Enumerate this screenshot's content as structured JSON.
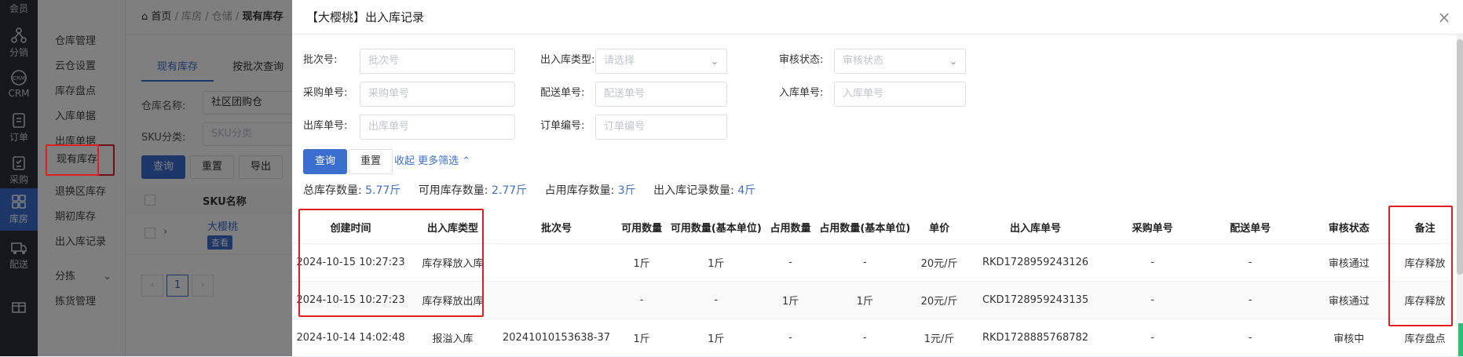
{
  "nav": {
    "items": [
      {
        "label": "会员",
        "icon": "member-icon"
      },
      {
        "label": "分销",
        "icon": "distribution-icon"
      },
      {
        "label": "CRM",
        "icon": "crm-icon"
      },
      {
        "label": "订单",
        "icon": "order-icon"
      },
      {
        "label": "采购",
        "icon": "purchase-icon"
      },
      {
        "label": "库房",
        "icon": "warehouse-icon"
      },
      {
        "label": "配送",
        "icon": "delivery-icon"
      },
      {
        "label": "",
        "icon": "gift-icon"
      }
    ]
  },
  "submenu": {
    "items": [
      "仓库管理",
      "云仓设置",
      "库存盘点",
      "入库单据",
      "出库单据",
      "现有库存",
      "退换区库存",
      "期初库存",
      "出入库记录",
      "分拣",
      "拣货管理"
    ]
  },
  "breadcrumb": {
    "home": "首页",
    "sep1": "/",
    "level1": "库房",
    "sep2": "/",
    "level2": "仓储",
    "sep3": "/",
    "current": "现有库存"
  },
  "bg": {
    "tabs": [
      "现有库存",
      "按批次查询"
    ],
    "warehouse_label": "仓库名称:",
    "warehouse_value": "社区团购仓",
    "sku_label": "SKU分类:",
    "sku_placeholder": "SKU分类",
    "btn_query": "查询",
    "btn_reset": "重置",
    "btn_export": "导出",
    "col_sku": "SKU名称",
    "row_name": "大樱桃",
    "row_view": "查看",
    "page": "1"
  },
  "modal": {
    "title": "【大樱桃】出入库记录",
    "filters": {
      "batch_label": "批次号:",
      "batch_placeholder": "批次号",
      "type_label": "出入库类型:",
      "type_placeholder": "请选择",
      "audit_label": "审核状态:",
      "audit_placeholder": "审核状态",
      "purchase_label": "采购单号:",
      "purchase_placeholder": "采购单号",
      "delivery_label": "配送单号:",
      "delivery_placeholder": "配送单号",
      "inbound_label": "入库单号:",
      "inbound_placeholder": "入库单号",
      "outbound_label": "出库单号:",
      "outbound_placeholder": "出库单号",
      "order_label": "订单编号:",
      "order_placeholder": "订单编号"
    },
    "buttons": {
      "query": "查询",
      "reset": "重置",
      "collapse": "收起 更多筛选"
    },
    "stats": {
      "total_label": "总库存数量:",
      "total_value": "5.77斤",
      "available_label": "可用库存数量:",
      "available_value": "2.77斤",
      "occupied_label": "占用库存数量:",
      "occupied_value": "3斤",
      "records_label": "出入库记录数量:",
      "records_value": "4斤"
    },
    "table": {
      "headers": [
        "创建时间",
        "出入库类型",
        "批次号",
        "可用数量",
        "可用数量(基本单位)",
        "占用数量",
        "占用数量(基本单位)",
        "单价",
        "出入库单号",
        "采购单号",
        "配送单号",
        "审核状态",
        "备注"
      ],
      "rows": [
        [
          "2024-10-15 10:27:23",
          "库存释放入库",
          "",
          "1斤",
          "1斤",
          "-",
          "-",
          "20元/斤",
          "RKD1728959243126",
          "-",
          "-",
          "审核通过",
          "库存释放"
        ],
        [
          "2024-10-15 10:27:23",
          "库存释放出库",
          "",
          "-",
          "-",
          "1斤",
          "1斤",
          "20元/斤",
          "CKD1728959243135",
          "-",
          "-",
          "审核通过",
          "库存释放"
        ],
        [
          "2024-10-14 14:02:48",
          "报溢入库",
          "20241010153638-37",
          "1斤",
          "1斤",
          "-",
          "-",
          "1元/斤",
          "RKD1728885768782",
          "-",
          "-",
          "审核中",
          "库存盘点"
        ]
      ]
    }
  },
  "colors": {
    "accent": "#3a6fd0",
    "highlight": "#e02020",
    "nav_bg": "#2b2f3a"
  }
}
